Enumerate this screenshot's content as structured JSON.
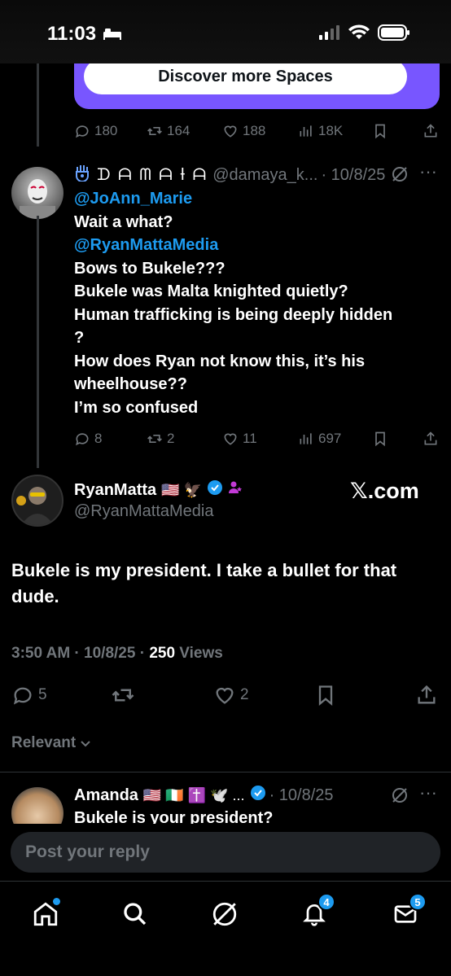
{
  "status_bar": {
    "time": "11:03"
  },
  "spaces_card": {
    "button_label": "Discover more Spaces"
  },
  "top_actions": {
    "replies": "180",
    "reposts": "164",
    "likes": "188",
    "views": "18K"
  },
  "reply_tweet": {
    "display_name": "ᗪ ᗩ ᗰ ᗩ Ɨ ᗩ",
    "handle": "@damaya_k...",
    "date": "· 10/8/25",
    "lines": [
      {
        "text": "@JoAnn_Marie",
        "mention": true
      },
      {
        "text": "Wait a what?",
        "mention": false
      },
      {
        "text": "@RyanMattaMedia",
        "mention": true
      },
      {
        "text": "Bows to Bukele???",
        "mention": false
      },
      {
        "text": "Bukele was Malta knighted quietly?",
        "mention": false
      },
      {
        "text": "Human trafficking is being deeply hidden",
        "mention": false
      },
      {
        "text": "?",
        "mention": false
      },
      {
        "text": "How does Ryan not know this, it’s his",
        "mention": false
      },
      {
        "text": "wheelhouse??",
        "mention": false
      },
      {
        "text": "I’m so confused",
        "mention": false
      }
    ],
    "actions": {
      "replies": "8",
      "reposts": "2",
      "likes": "11",
      "views": "697"
    }
  },
  "main_tweet": {
    "display_name": "RyanMatta",
    "emojis": "🇺🇸 🦅",
    "handle": "@RyanMattaMedia",
    "watermark": "𝕏.com",
    "text": "Bukele is my president. I take a bullet for that dude.",
    "meta_time": "3:50 AM · 10/8/25 · ",
    "meta_views_count": "250",
    "meta_views_label": " Views",
    "actions": {
      "replies": "5",
      "likes": "2"
    }
  },
  "sort": {
    "label": "Relevant"
  },
  "next_tweet": {
    "display_name": "Amanda",
    "emojis": "🇺🇸 🇮🇪 ✝️ 🕊️ ...",
    "date": "· 10/8/25",
    "text": "Bukele is your president?"
  },
  "reply_input": {
    "placeholder": "Post your reply"
  },
  "tabs": {
    "notifications_badge": "4",
    "messages_badge": "5"
  },
  "colors": {
    "accent": "#1d9bf0",
    "spaces": "#7856ff",
    "background": "#000000"
  }
}
